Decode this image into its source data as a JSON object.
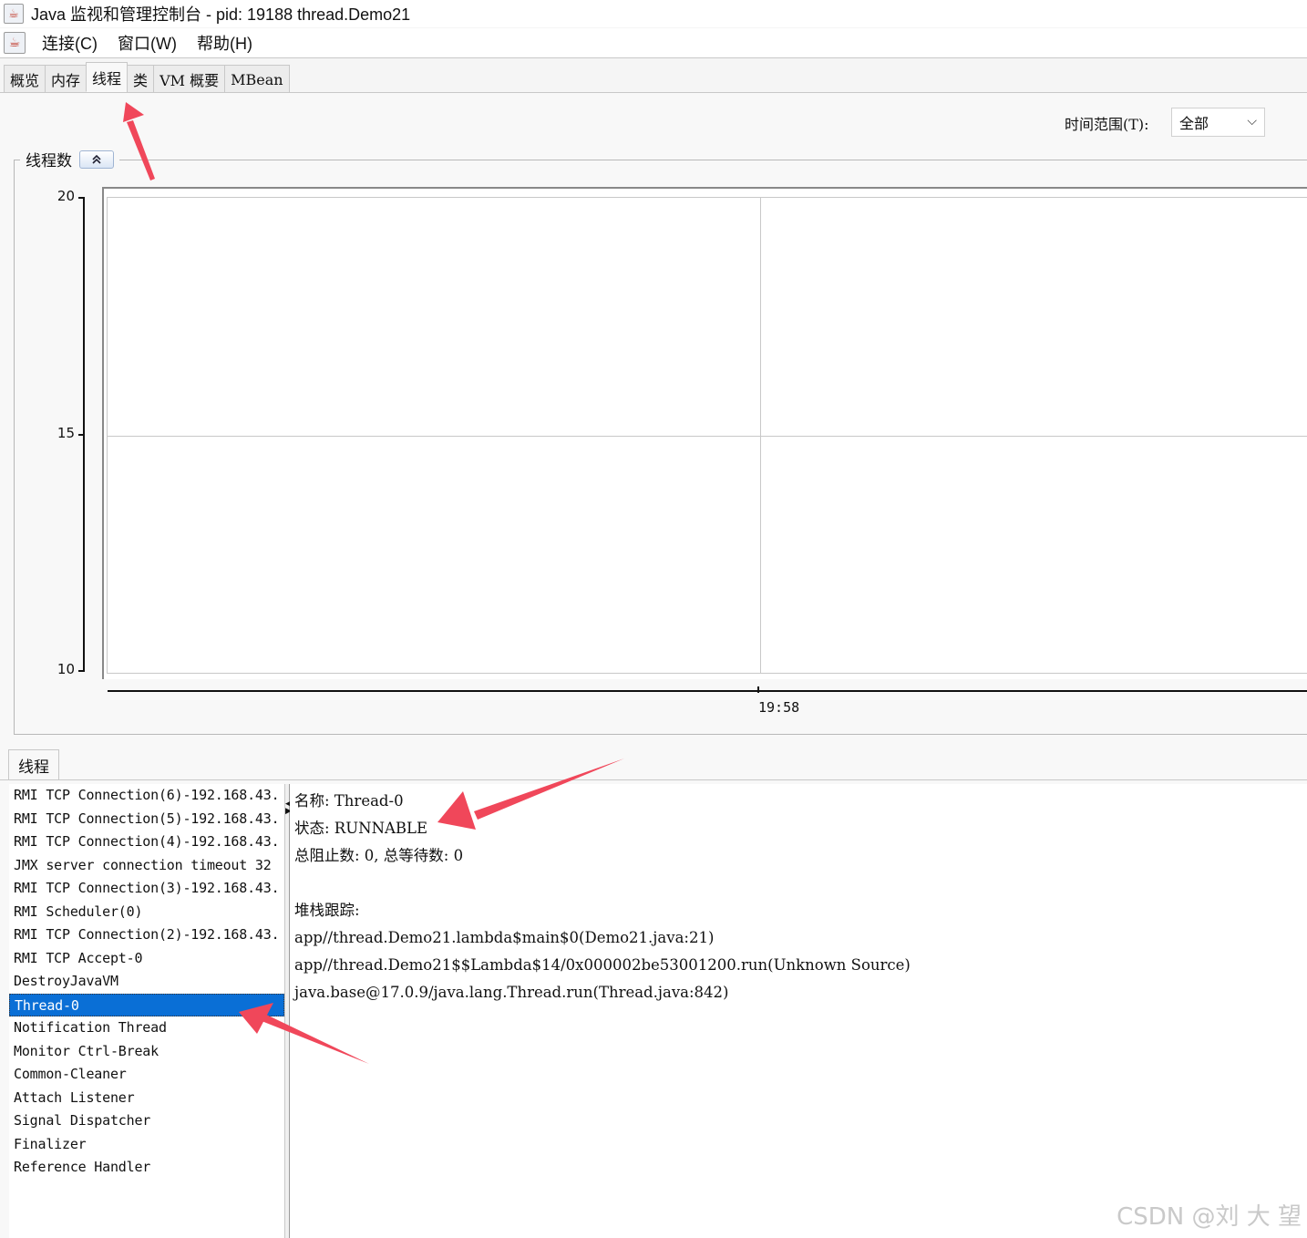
{
  "window": {
    "title": "Java 监视和管理控制台 - pid: 19188 thread.Demo21",
    "icon": "java-cup-icon"
  },
  "menu": {
    "items": [
      "连接(C)",
      "窗口(W)",
      "帮助(H)"
    ]
  },
  "tabs": [
    {
      "label": "概览",
      "active": false
    },
    {
      "label": "内存",
      "active": false
    },
    {
      "label": "线程",
      "active": true
    },
    {
      "label": "类",
      "active": false
    },
    {
      "label": "VM 概要",
      "active": false
    },
    {
      "label": "MBean",
      "active": false
    }
  ],
  "time_range": {
    "label": "时间范围(T):",
    "value": "全部",
    "icon": "chevron-down-icon"
  },
  "chart_panel": {
    "title": "线程数",
    "collapse_icon": "double-chevron-up-icon"
  },
  "chart_data": {
    "type": "line",
    "title": "线程数",
    "y_ticks": [
      "20",
      "15",
      "10"
    ],
    "ylim": [
      10,
      20
    ],
    "x_ticks": [
      "19:58"
    ],
    "grid": true,
    "series": []
  },
  "threads_panel": {
    "tab_label": "线程",
    "selected": "Thread-0",
    "threads": [
      "RMI TCP Connection(6)-192.168.43.",
      "RMI TCP Connection(5)-192.168.43.",
      "RMI TCP Connection(4)-192.168.43.",
      "JMX server connection timeout 32",
      "RMI TCP Connection(3)-192.168.43.",
      "RMI Scheduler(0)",
      "RMI TCP Connection(2)-192.168.43.",
      "RMI TCP Accept-0",
      "DestroyJavaVM",
      "Thread-0",
      "Notification Thread",
      "Monitor Ctrl-Break",
      "Common-Cleaner",
      "Attach Listener",
      "Signal Dispatcher",
      "Finalizer",
      "Reference Handler"
    ]
  },
  "thread_details": {
    "name_line": "名称: Thread-0",
    "state_line": "状态: RUNNABLE",
    "counts_line": "总阻止数: 0, 总等待数: 0",
    "blank": "",
    "stack_title": "堆栈跟踪:",
    "stack": [
      "app//thread.Demo21.lambda$main$0(Demo21.java:21)",
      "app//thread.Demo21$$Lambda$14/0x000002be53001200.run(Unknown Source)",
      "java.base@17.0.9/java.lang.Thread.run(Thread.java:842)"
    ]
  },
  "watermark": "CSDN @刘 大 望",
  "colors": {
    "selection": "#0a6fd6",
    "annotation_arrow": "#f0475a"
  }
}
